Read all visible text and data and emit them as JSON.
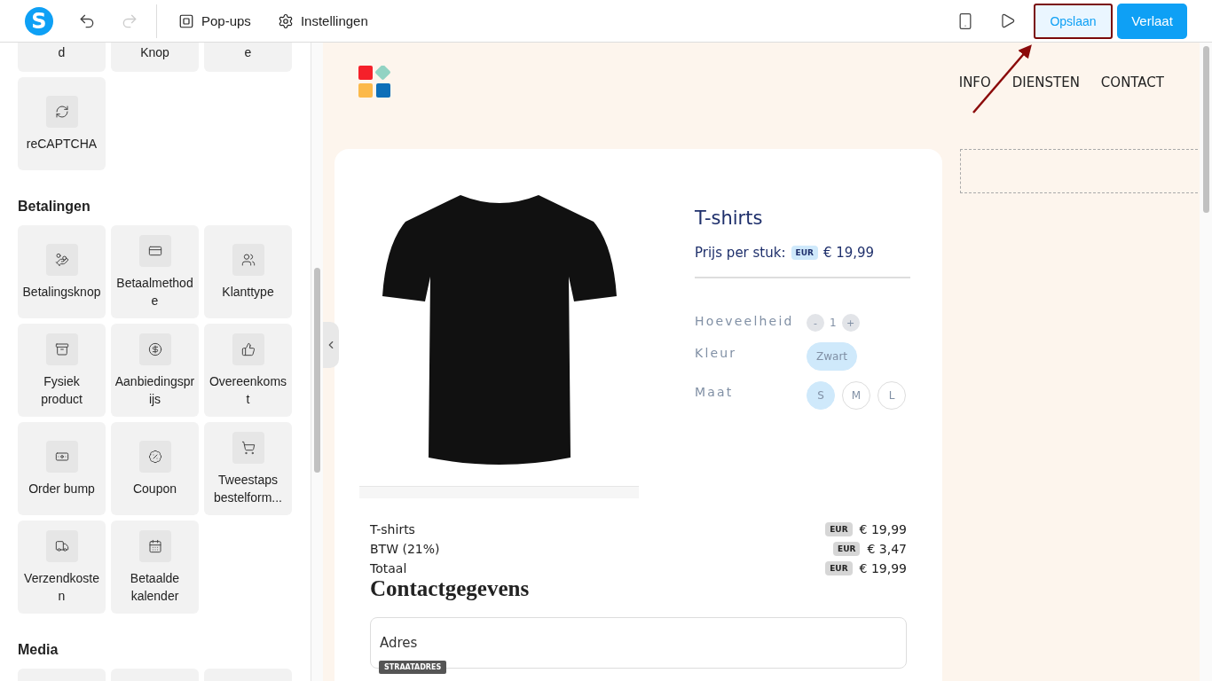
{
  "toolbar": {
    "logo": "S",
    "undo_disabled": false,
    "redo_disabled": true,
    "menu": [
      {
        "label": "Pop-ups"
      },
      {
        "label": "Instellingen"
      }
    ],
    "save": {
      "label": "Opslaan",
      "highlighted": true
    },
    "exit": {
      "label": "Verlaat"
    }
  },
  "sidebar": {
    "top_tiles": [
      {
        "label": "d"
      },
      {
        "label": "Knop"
      },
      {
        "label": "e"
      }
    ],
    "extra_tiles": [
      {
        "label": "reCAPTCHA"
      }
    ],
    "sections": [
      {
        "title": "Betalingen",
        "tiles": [
          {
            "label": "Betalingsknop"
          },
          {
            "label": "Betaalmethode"
          },
          {
            "label": "Klanttype"
          },
          {
            "label": "Fysiek product"
          },
          {
            "label": "Aanbiedingsprijs"
          },
          {
            "label": "Overeenkomst"
          },
          {
            "label": "Order bump"
          },
          {
            "label": "Coupon"
          },
          {
            "label": "Tweestaps bestelform..."
          },
          {
            "label": "Verzendkosten"
          },
          {
            "label": "Betaalde kalender"
          }
        ]
      },
      {
        "title": "Media"
      }
    ]
  },
  "site": {
    "nav": [
      "INFO",
      "DIENSTEN",
      "CONTACT"
    ],
    "product": {
      "title": "T-shirts",
      "price_label": "Prijs per stuk:",
      "currency": "EUR",
      "price": "€ 19,99",
      "quantity": {
        "label": "Hoeveelheid",
        "minus": "-",
        "value": "1",
        "plus": "+"
      },
      "options": [
        {
          "label": "Kleur",
          "values": [
            {
              "label": "Zwart",
              "selected": true
            }
          ]
        },
        {
          "label": "Maat",
          "values": [
            {
              "label": "S",
              "selected": true
            },
            {
              "label": "M",
              "selected": false
            },
            {
              "label": "L",
              "selected": false
            }
          ]
        }
      ]
    },
    "summary": [
      {
        "label": "T-shirts",
        "currency": "EUR",
        "amount": "€ 19,99"
      },
      {
        "label": "BTW (21%)",
        "currency": "EUR",
        "amount": "€ 3,47"
      },
      {
        "label": "Totaal",
        "currency": "EUR",
        "amount": "€ 19,99"
      }
    ],
    "contact": {
      "title": "Contactgegevens",
      "field_label": "Adres",
      "field_tag": "STRAATADRES"
    }
  }
}
